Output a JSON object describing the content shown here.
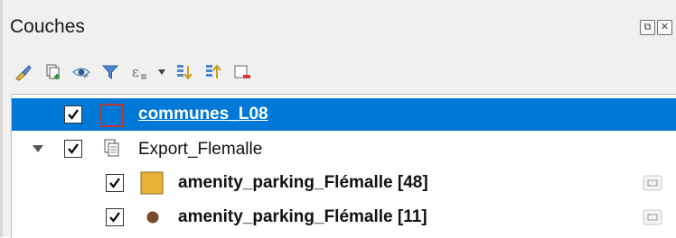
{
  "panel": {
    "title": "Couches",
    "float_glyph": "⧉",
    "close_glyph": "✕"
  },
  "toolbar": {
    "items": [
      {
        "name": "style-manager-icon"
      },
      {
        "name": "add-group-icon"
      },
      {
        "name": "manage-visibility-icon"
      },
      {
        "name": "filter-legend-icon"
      },
      {
        "name": "filter-expression-icon"
      },
      {
        "name": "expand-all-icon"
      },
      {
        "name": "collapse-all-icon"
      },
      {
        "name": "remove-layer-icon"
      }
    ]
  },
  "layers": [
    {
      "label": "communes_L08",
      "checked": true,
      "selected": true,
      "symbol": "polygon-outline",
      "symbol_color": "#c0392b"
    },
    {
      "label": "Export_Flemalle",
      "checked": true,
      "selected": false,
      "group": true,
      "expanded": true
    },
    {
      "label": "amenity_parking_Flémalle [48]",
      "checked": true,
      "selected": false,
      "symbol": "square-fill",
      "symbol_color": "#e8b339",
      "indicator": "embedded-layer-icon"
    },
    {
      "label": "amenity_parking_Flémalle [11]",
      "checked": true,
      "selected": false,
      "symbol": "circle-fill",
      "symbol_color": "#7a4a2a",
      "indicator": "embedded-layer-icon"
    }
  ],
  "colors": {
    "selection": "#0078d7"
  }
}
